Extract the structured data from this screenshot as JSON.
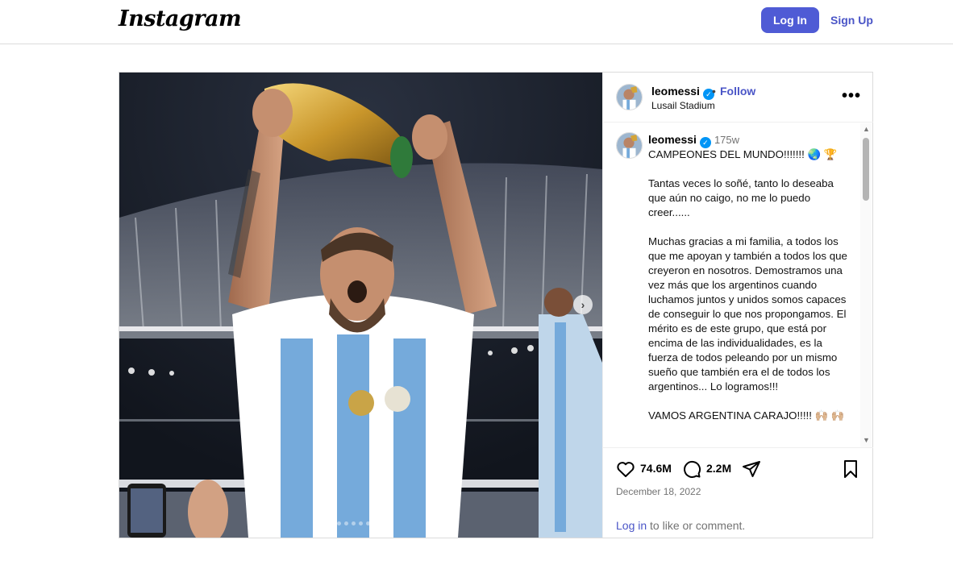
{
  "header": {
    "logo": "Instagram",
    "login_label": "Log In",
    "signup_label": "Sign Up"
  },
  "post": {
    "username": "leomessi",
    "verified_glyph": "✓",
    "separator": "•",
    "follow_label": "Follow",
    "location": "Lusail Stadium",
    "more_icon": "•••",
    "caption": {
      "username": "leomessi",
      "time": "175w",
      "text": "CAMPEONES DEL MUNDO!!!!!!! 🌏 🏆\n\nTantas veces lo soñé, tanto lo deseaba que aún no caigo, no me lo puedo creer......\n\nMuchas gracias a mi familia, a todos los que me apoyan y también a todos los que creyeron en nosotros. Demostramos una vez más que los argentinos cuando luchamos juntos y unidos somos capaces de conseguir lo que nos propongamos. El mérito es de este grupo, que está por encima de las individualidades, es la fuerza de todos peleando por un mismo sueño que también era el de todos los argentinos... Lo logramos!!!\n\nVAMOS ARGENTINA CARAJO!!!!! 🙌🏼 🙌🏼"
    },
    "likes": "74.6M",
    "comments": "2.2M",
    "date": "December 18, 2022",
    "login_link": "Log in",
    "login_suffix": " to like or comment.",
    "carousel": {
      "slide_count": 7,
      "current_index": 0,
      "next_icon": "›"
    }
  },
  "colors": {
    "accent": "#4f5bd5",
    "link": "#4a55c7",
    "verified": "#0095f6",
    "jersey_blue": "#75aadb"
  },
  "icons": [
    "heart-icon",
    "comment-icon",
    "share-icon",
    "bookmark-icon",
    "more-icon",
    "verified-icon",
    "chevron-right-icon"
  ]
}
